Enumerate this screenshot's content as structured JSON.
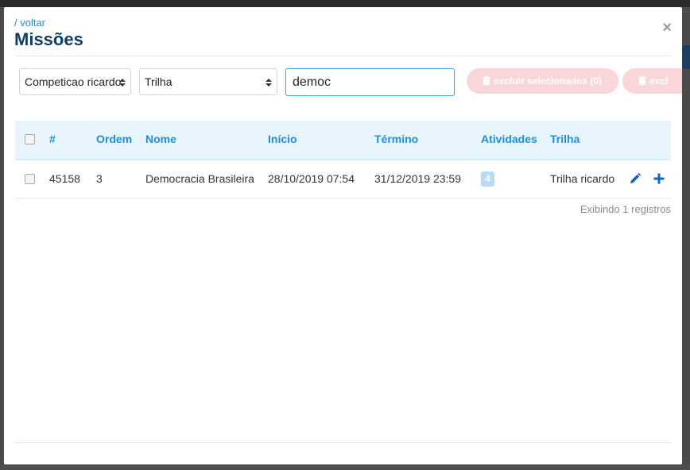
{
  "modal": {
    "back_label": "/ voltar",
    "title": "Missões",
    "close_label": "×"
  },
  "filters": {
    "competition_select": "Competicao ricardo",
    "trilha_select": "Trilha",
    "search_value": "democ",
    "delete_selected_label": "excluir selecionados (0)",
    "delete_label_2": "excl"
  },
  "table": {
    "columns": [
      "#",
      "Ordem",
      "Nome",
      "Início",
      "Término",
      "Atividades",
      "Trilha"
    ],
    "rows": [
      {
        "id": "45158",
        "ordem": "3",
        "nome": "Democracia Brasileira",
        "inicio": "28/10/2019 07:54",
        "termino": "31/12/2019 23:59",
        "atividades": "4",
        "trilha": "Trilha ricardo"
      }
    ],
    "footer": "Exibindo 1 registros"
  },
  "icons": {
    "edit": "pencil-icon",
    "add": "plus-icon",
    "trash": "trash-icon",
    "caret": "sort-caret-icon"
  },
  "colors": {
    "accent": "#1e90d6",
    "title": "#0f3d66",
    "header_bg": "#e8f5fd",
    "delete_btn": "#f9d6d9",
    "badge": "#b6dcf7",
    "icon": "#1565c0"
  }
}
